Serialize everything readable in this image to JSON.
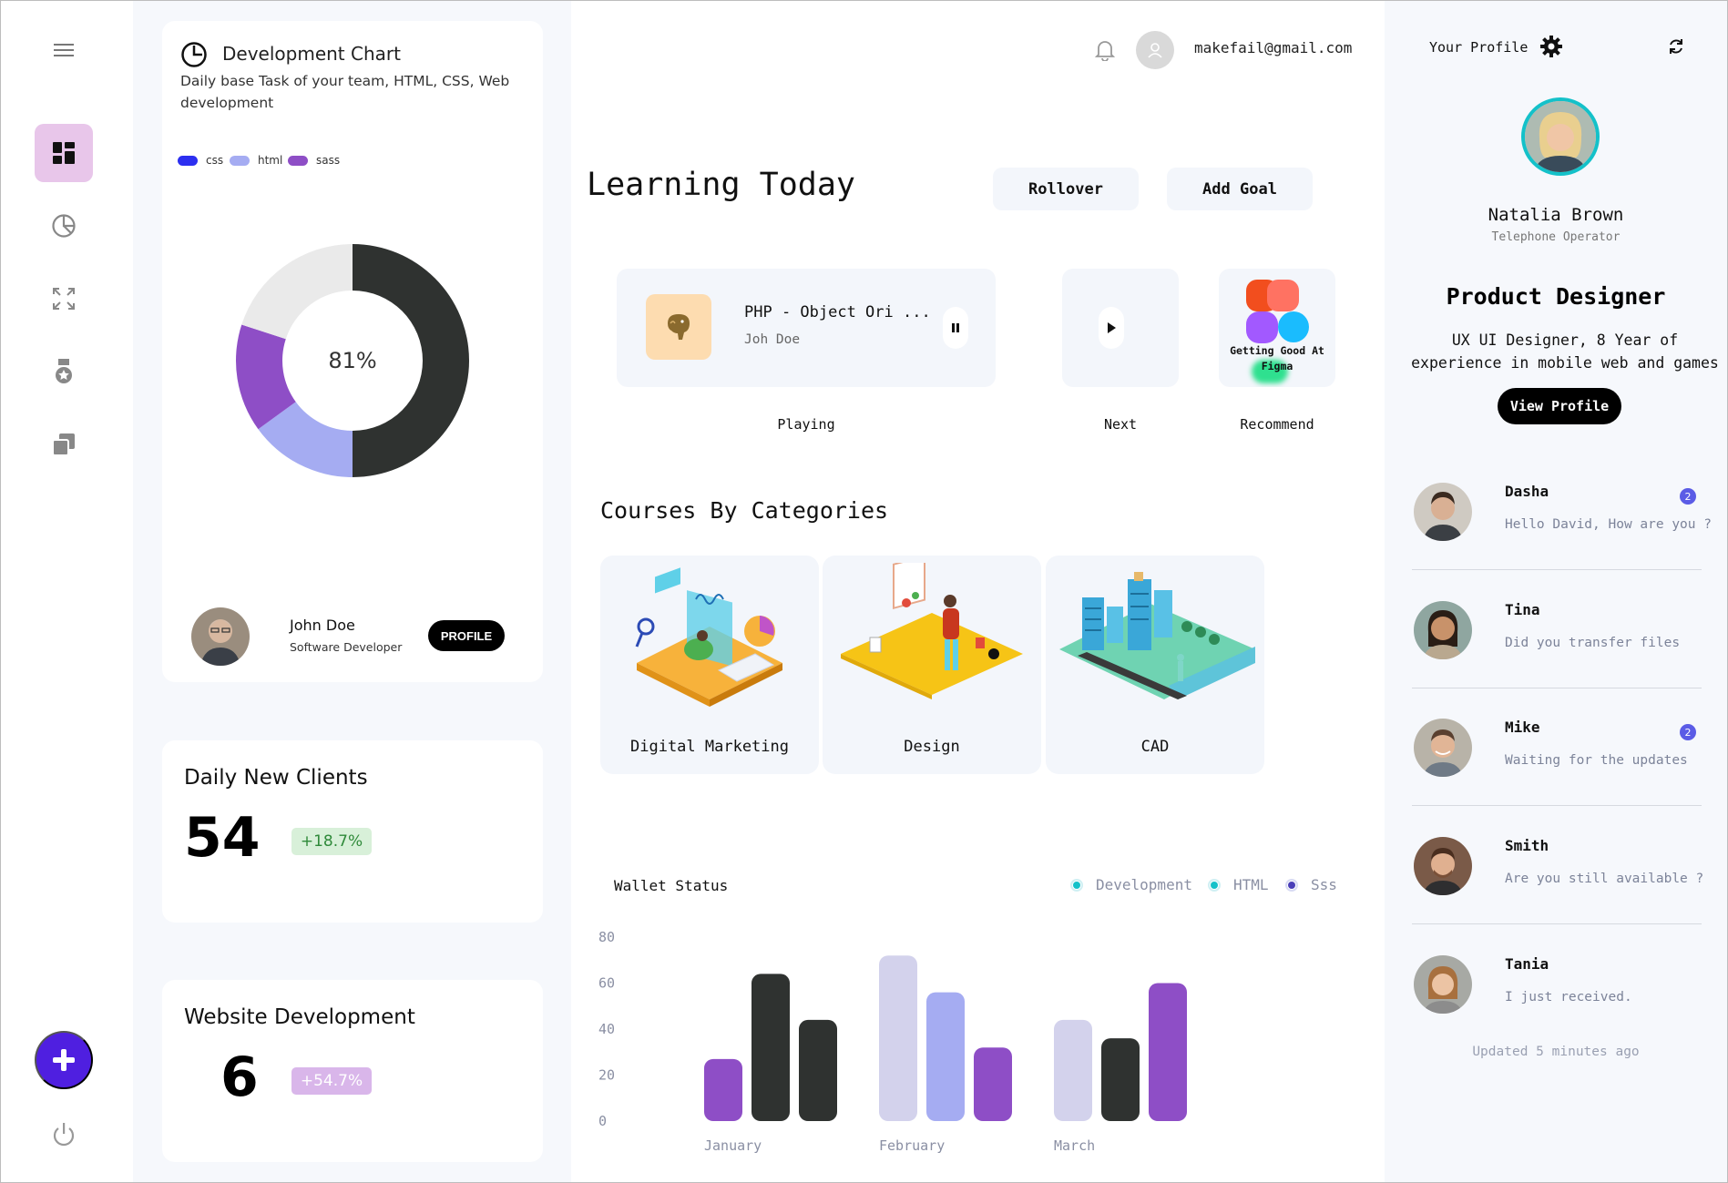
{
  "sidebar": {
    "items": [
      {
        "icon": "menu-icon"
      },
      {
        "icon": "dashboard-icon",
        "active": true
      },
      {
        "icon": "pie-chart-icon"
      },
      {
        "icon": "expand-icon"
      },
      {
        "icon": "medal-icon"
      },
      {
        "icon": "layers-icon"
      }
    ],
    "fab_icon": "plus-icon",
    "bottom_icon": "power-icon",
    "accent": "#4f1fe0",
    "active_bg": "#e8c6ea"
  },
  "dev_chart": {
    "title": "Development Chart",
    "subtitle": "Daily base Task of your team, HTML, CSS, Web development",
    "legend": [
      {
        "label": "css",
        "color": "#2c2ff0"
      },
      {
        "label": "html",
        "color": "#a5acf2"
      },
      {
        "label": "sass",
        "color": "#8e4ec6"
      }
    ],
    "center_label": "81%",
    "user": {
      "name": "John Doe",
      "role": "Software Developer",
      "button": "PROFILE"
    }
  },
  "chart_data": [
    {
      "type": "pie",
      "title": "Development Chart",
      "center_label": "81%",
      "slices": [
        {
          "label": "",
          "value": 50,
          "color": "#2f3230"
        },
        {
          "label": "html",
          "value": 15,
          "color": "#a5acf2"
        },
        {
          "label": "sass",
          "value": 15,
          "color": "#8e4ec6"
        },
        {
          "label": "",
          "value": 20,
          "color": "#eaeaea"
        }
      ]
    },
    {
      "type": "bar",
      "title": "Wallet Status",
      "categories": [
        "January",
        "February",
        "March"
      ],
      "ylim": [
        0,
        80
      ],
      "yticks": [
        0,
        20,
        40,
        60,
        80
      ],
      "bars": [
        [
          {
            "value": 27,
            "color": "#8e4ec6"
          },
          {
            "value": 64,
            "color": "#2f3230"
          },
          {
            "value": 44,
            "color": "#2f3230"
          }
        ],
        [
          {
            "value": 72,
            "color": "#d3d2ec"
          },
          {
            "value": 56,
            "color": "#a5acf2"
          },
          {
            "value": 32,
            "color": "#8e4ec6"
          }
        ],
        [
          {
            "value": 44,
            "color": "#d3d2ec"
          },
          {
            "value": 36,
            "color": "#2f3230"
          },
          {
            "value": 60,
            "color": "#8e4ec6"
          }
        ]
      ],
      "legend": [
        {
          "label": "Development",
          "color": "#14c1c9"
        },
        {
          "label": "HTML",
          "color": "#14c1c9"
        },
        {
          "label": "Sss",
          "color": "#4a3fb8"
        }
      ]
    }
  ],
  "stats": [
    {
      "title": "Daily New Clients",
      "value": "54",
      "change": "+18.7%",
      "badge_bg": "#d8f0d9",
      "badge_color": "#2f8a3a"
    },
    {
      "title": "Website Development",
      "value": "6",
      "change": "+54.7%",
      "badge_bg": "#d9b6ea",
      "badge_color": "#ffffff"
    }
  ],
  "header": {
    "email": "makefail@gmail.com",
    "bell_icon": "bell-icon",
    "avatar_icon": "user-icon"
  },
  "learning": {
    "title": "Learning Today",
    "buttons": [
      "Rollover",
      "Add Goal"
    ],
    "playing": {
      "course": "PHP - Object Ori ...",
      "author": "Joh Doe",
      "label": "Playing"
    },
    "next": {
      "label": "Next"
    },
    "recommend": {
      "text": "Getting Good At Figma",
      "label": "Recommend"
    }
  },
  "courses": {
    "title": "Courses By Categories",
    "items": [
      "Digital Marketing",
      "Design",
      "CAD"
    ]
  },
  "wallet": {
    "title": "Wallet Status",
    "legend": [
      "Development",
      "HTML",
      "Sss"
    ],
    "yticks": [
      "80",
      "60",
      "40",
      "20",
      "0"
    ],
    "months": [
      "January",
      "February",
      "March"
    ]
  },
  "profile": {
    "label": "Your Profile",
    "name": "Natalia Brown",
    "role": "Telephone Operator",
    "title": "Product Designer",
    "description": "UX UI Designer, 8 Year of experience in mobile web and games",
    "button": "View Profile"
  },
  "messages": [
    {
      "name": "Dasha",
      "text": "Hello David, How are you ?",
      "badge": "2"
    },
    {
      "name": "Tina",
      "text": "Did you transfer files",
      "badge": ""
    },
    {
      "name": "Mike",
      "text": "Waiting for the updates",
      "badge": "2"
    },
    {
      "name": "Smith",
      "text": "Are you still available ?",
      "badge": ""
    },
    {
      "name": "Tania",
      "text": "I just received.",
      "badge": ""
    }
  ],
  "updated": "Updated 5 minutes ago"
}
